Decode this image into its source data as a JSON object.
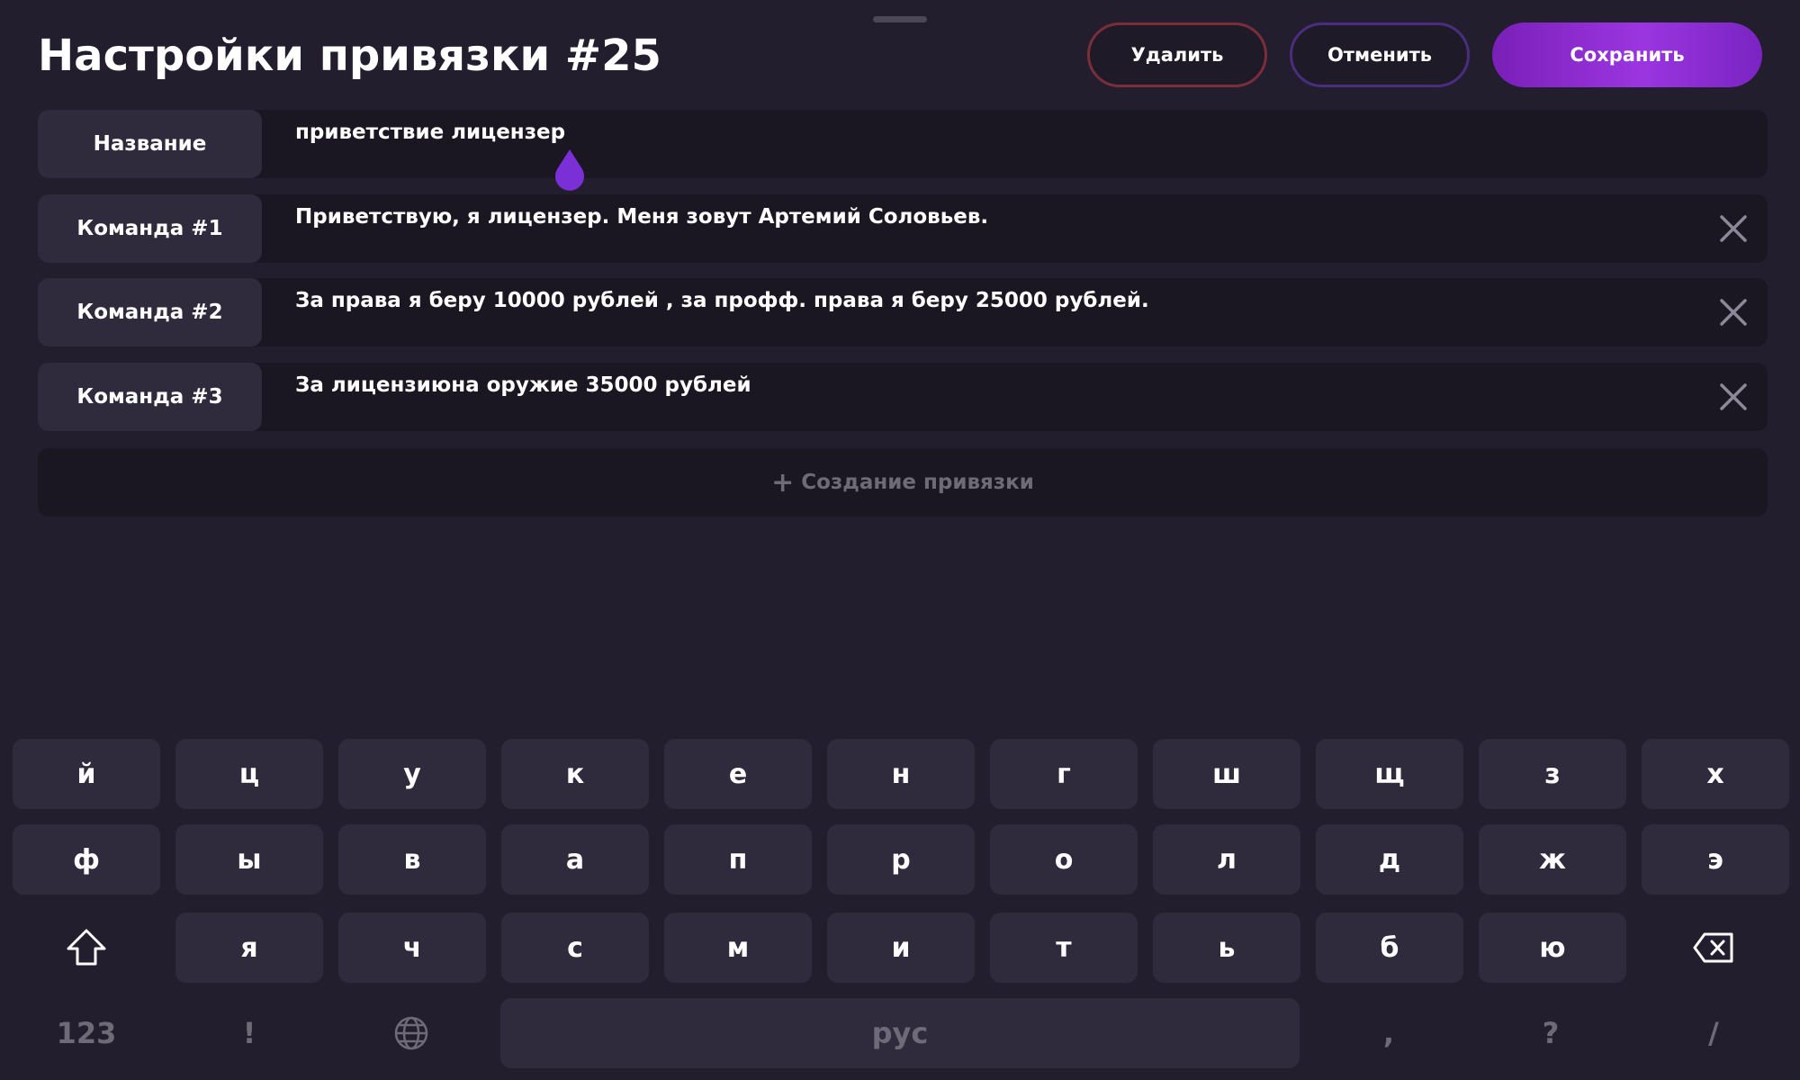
{
  "header": {
    "title": "Настройки привязки #25",
    "delete_label": "Удалить",
    "cancel_label": "Отменить",
    "save_label": "Сохранить"
  },
  "fields": {
    "name_label": "Название",
    "name_value": "приветствие лицензер",
    "commands": [
      {
        "label": "Команда #1",
        "value": "Приветствую, я лицензер. Меня зовут Артемий Соловьев."
      },
      {
        "label": "Команда #2",
        "value": "За права я беру 10000 рублей , за профф. права я беру 25000 рублей."
      },
      {
        "label": "Команда #3",
        "value": "За лицензиюна оружие 35000 рублей"
      }
    ],
    "add_label": "Создание привязки",
    "add_icon": "+"
  },
  "keyboard": {
    "row1": [
      "й",
      "ц",
      "у",
      "к",
      "е",
      "н",
      "г",
      "ш",
      "щ",
      "з",
      "х"
    ],
    "row2": [
      "ф",
      "ы",
      "в",
      "а",
      "п",
      "р",
      "о",
      "л",
      "д",
      "ж",
      "э"
    ],
    "row3": [
      "я",
      "ч",
      "с",
      "м",
      "и",
      "т",
      "ь",
      "б",
      "ю"
    ],
    "numbers_label": "123",
    "exclamation": "!",
    "space_label": "рус",
    "comma": ",",
    "question": "?",
    "slash": "/",
    "icons": {
      "shift": "shift-icon",
      "backspace": "backspace-icon",
      "globe": "globe-icon"
    }
  },
  "colors": {
    "background": "#221e2d",
    "accent": "#9b35e0",
    "delete_border": "#7a2e3a",
    "cancel_border": "#4a2d7e",
    "key": "#2f2a3c",
    "muted_text": "#6e6a78"
  }
}
